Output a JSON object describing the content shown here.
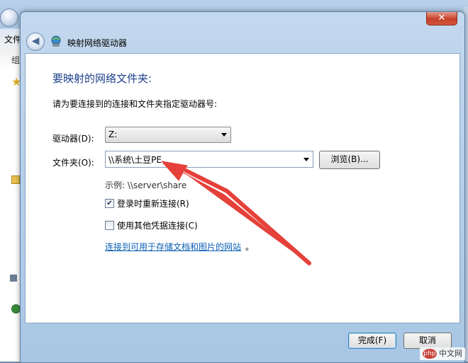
{
  "background": {
    "menu_label": "文件",
    "toolbar_label": "组"
  },
  "dialog": {
    "close_symbol": "✕",
    "back_symbol": "◀",
    "title": "映射网络驱动器",
    "heading": "要映射的网络文件夹:",
    "description": "请为要连接到的连接和文件夹指定驱动器号:",
    "drive_label": "驱动器(D):",
    "drive_value": "Z:",
    "folder_label": "文件夹(O):",
    "folder_value": "\\\\系统\\土豆PE",
    "browse_label": "浏览(B)...",
    "example_text": "示例: \\\\server\\share",
    "reconnect_label": "登录时重新连接(R)",
    "reconnect_checked": true,
    "credentials_label": "使用其他凭据连接(C)",
    "credentials_checked": false,
    "link_text": "连接到可用于存储文档和图片的网站",
    "link_suffix": "。",
    "finish_label": "完成(F)",
    "cancel_label": "取消"
  },
  "annotation_color": "#e5413a",
  "watermark": {
    "badge": "php",
    "text": "中文网"
  }
}
